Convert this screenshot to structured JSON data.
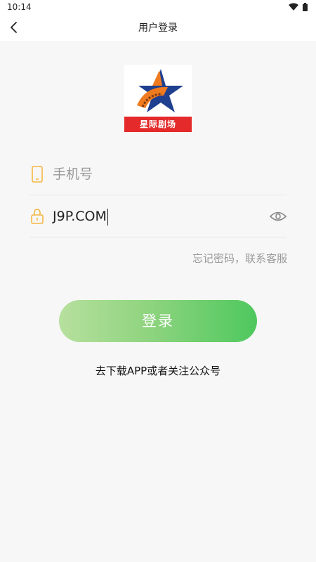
{
  "status_bar": {
    "time": "10:14"
  },
  "header": {
    "title": "用户登录"
  },
  "logo": {
    "text": "星际剧场"
  },
  "phone_field": {
    "placeholder": "手机号",
    "value": ""
  },
  "password_field": {
    "value": "J9P.COM"
  },
  "forgot_link": "忘记密码，联系客服",
  "login_button": "登录",
  "download_link": "去下载APP或者关注公众号",
  "colors": {
    "accent": "#f5b642",
    "button_start": "#b6e09e",
    "button_end": "#4ec85e",
    "logo_red": "#e42a2a",
    "logo_blue": "#1f3f8f",
    "logo_orange": "#f07a1e"
  }
}
